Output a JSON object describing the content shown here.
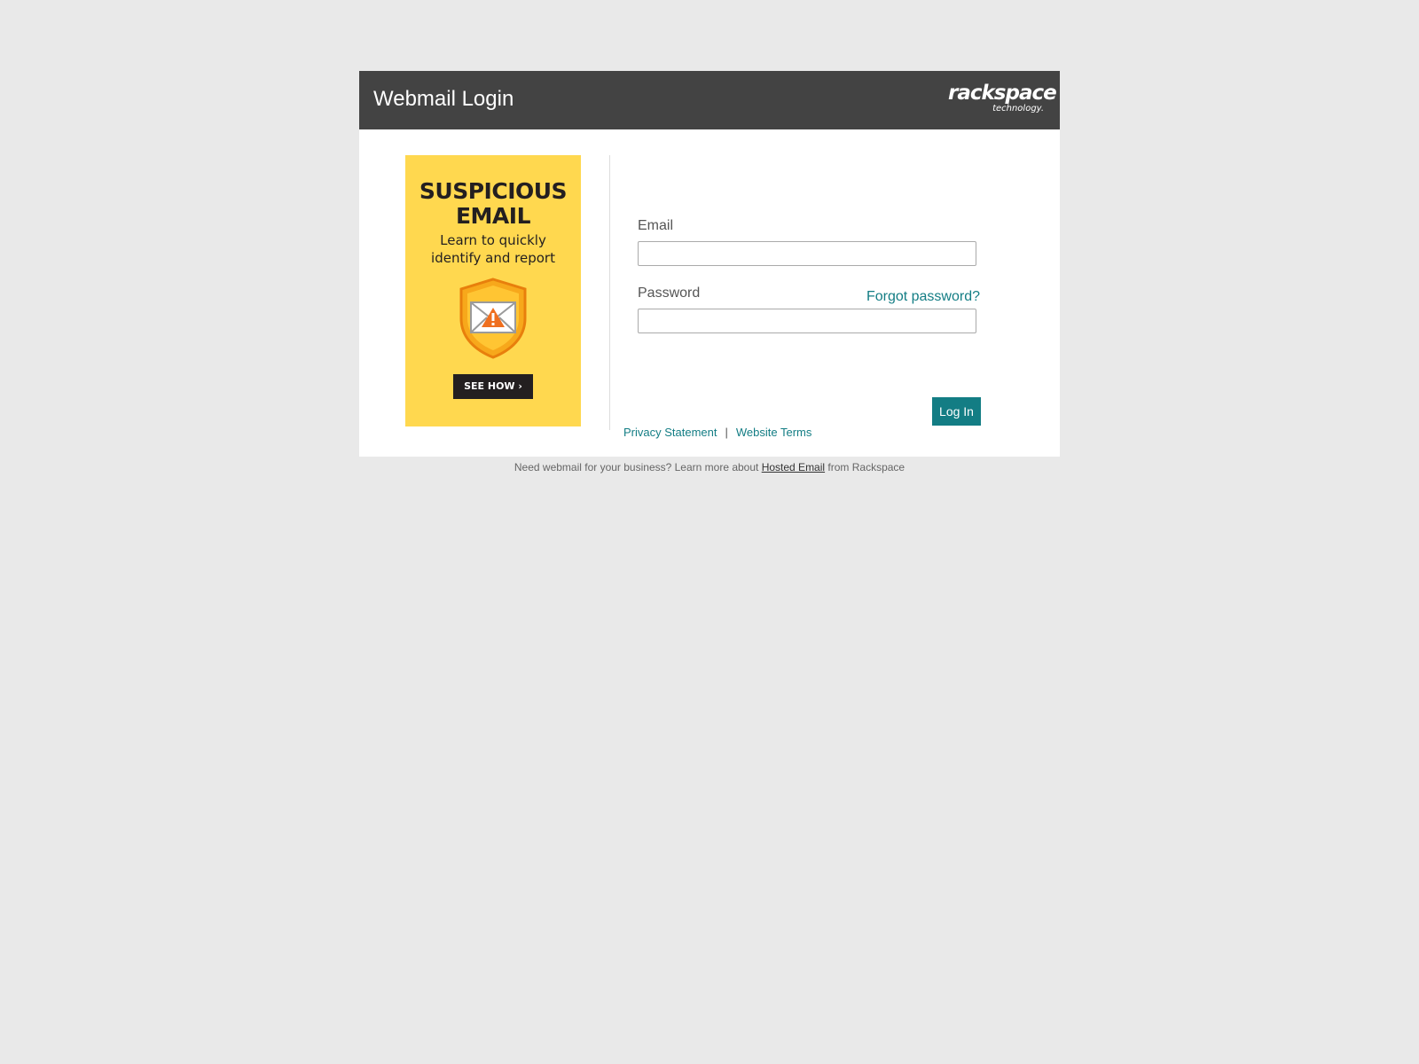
{
  "header": {
    "title": "Webmail Login",
    "brand_main": "rackspace",
    "brand_sub": "technology."
  },
  "promo": {
    "heading": "SUSPICIOUS\nEMAIL",
    "subtext": "Learn to quickly\nidentify and report",
    "cta_label": "SEE HOW ›",
    "icon": "shield-envelope-warning-icon",
    "background_color": "#ffd84f"
  },
  "form": {
    "email_label": "Email",
    "email_value": "",
    "password_label": "Password",
    "password_value": "",
    "forgot_label": "Forgot password?",
    "login_label": "Log In"
  },
  "footer_links": {
    "privacy": "Privacy Statement",
    "separator": "|",
    "terms": "Website Terms"
  },
  "bottom_note": {
    "prefix": "Need webmail for your business? Learn more about ",
    "link": "Hosted Email",
    "suffix": " from Rackspace"
  },
  "colors": {
    "accent": "#137d84",
    "header_bg": "#434343",
    "page_bg": "#e9e9e9"
  }
}
